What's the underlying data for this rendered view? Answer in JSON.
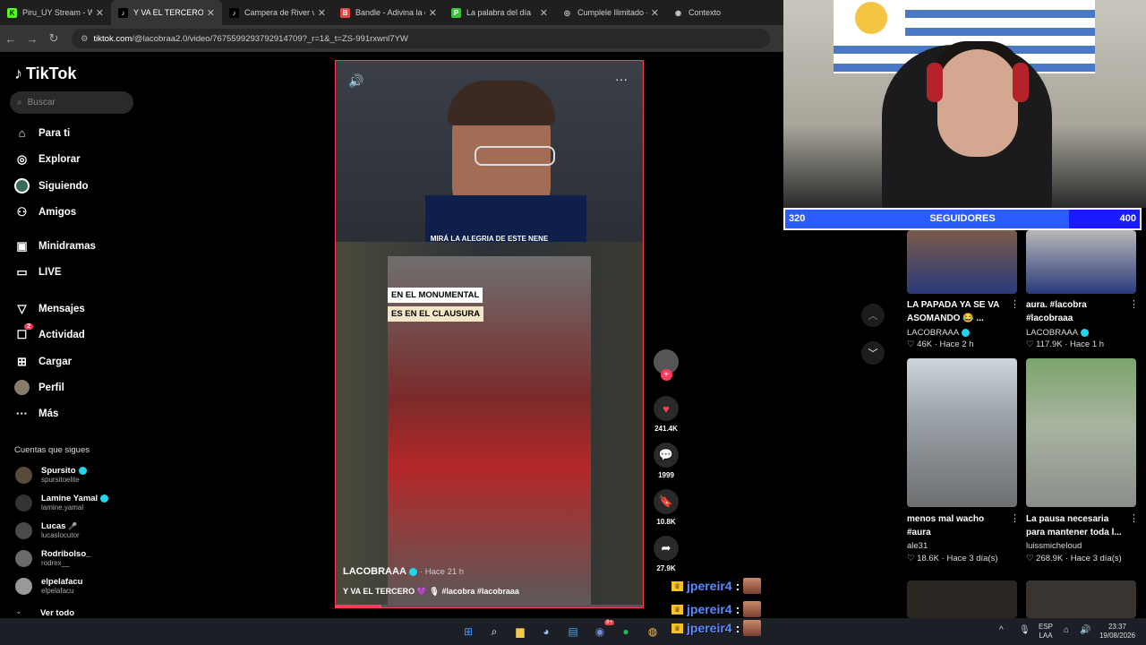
{
  "browser": {
    "tabs": [
      {
        "label": "Piru_UY Stream - Wat",
        "fav": "K",
        "fav_color": "#53fc18"
      },
      {
        "label": "Y VA EL TERCERO",
        "fav": "♪",
        "fav_color": "#ffffff",
        "active": true
      },
      {
        "label": "Campera de River vs",
        "fav": "♪",
        "fav_color": "#ffffff"
      },
      {
        "label": "Bandle - Adivina la ca",
        "fav": "B",
        "fav_color": "#e84545"
      },
      {
        "label": "La palabra del día",
        "fav": "P",
        "fav_color": "#3cc23c"
      },
      {
        "label": "Cumplele Ilimitado -",
        "fav": "◎",
        "fav_color": "#cccccc"
      },
      {
        "label": "Contexto",
        "fav": "◉",
        "fav_color": "#cccccc"
      }
    ],
    "url_domain": "tiktok.com",
    "url_path": "/@lacobraa2.0/video/7675599293792914709?_r=1&_t=ZS-991rxwnl7YW"
  },
  "sidebar": {
    "brand": "TikTok",
    "search_placeholder": "Buscar",
    "nav": [
      {
        "label": "Para ti",
        "icon": "home-icon"
      },
      {
        "label": "Explorar",
        "icon": "compass-icon"
      },
      {
        "label": "Siguiendo",
        "icon": "following-icon"
      },
      {
        "label": "Amigos",
        "icon": "friends-icon"
      },
      {
        "label": "Minidramas",
        "icon": "minidrama-icon"
      },
      {
        "label": "LIVE",
        "icon": "live-icon"
      },
      {
        "label": "Mensajes",
        "icon": "messages-icon"
      },
      {
        "label": "Actividad",
        "icon": "activity-icon",
        "badge": "2"
      },
      {
        "label": "Cargar",
        "icon": "upload-icon"
      },
      {
        "label": "Perfil",
        "icon": "profile-icon"
      },
      {
        "label": "Más",
        "icon": "more-icon"
      }
    ],
    "following_header": "Cuentas que sigues",
    "following": [
      {
        "name": "Spursito",
        "handle": "spursitoelite",
        "verified": true
      },
      {
        "name": "Lamine Yamal",
        "handle": "lamine.yamal",
        "verified": true
      },
      {
        "name": "Lucas",
        "handle": "lucaslocutor",
        "verified": false
      },
      {
        "name": "Rodribolso_",
        "handle": "rodrex__",
        "verified": false
      },
      {
        "name": "elpelafacu",
        "handle": "elpelafacu",
        "verified": false
      }
    ],
    "see_all": "Ver todo"
  },
  "video": {
    "top_caption": "MIRÁ LA ALEGRIA DE ESTE NENE",
    "overlay_line1": "EN EL MONUMENTAL",
    "overlay_line2": "ES EN EL CLAUSURA",
    "author": "LACOBRAAA",
    "ago": "· Hace 21 h",
    "description": "Y VA EL TERCERO 💜 🎙 #lacobra #lacobraaa",
    "progress": 0.15
  },
  "actions": {
    "likes": "241.4K",
    "comments": "1999",
    "saves": "10.8K",
    "shares": "27.9K"
  },
  "followers_bar": {
    "current": "320",
    "label": "SEGUIDORES",
    "goal": "400",
    "progress": 0.8
  },
  "related": [
    {
      "title": "LA PAPADA YA SE VA ASOMANDO 😂 ...",
      "author": "LACOBRAAA",
      "likes": "46K",
      "ago": "Hace 2 h"
    },
    {
      "title": "aura. #lacobra #lacobraaa",
      "author": "LACOBRAAA",
      "likes": "117.9K",
      "ago": "Hace 1 h"
    },
    {
      "title": "menos mal wacho #aura",
      "author": "ale31",
      "likes": "18.6K",
      "ago": "Hace 3 día(s)"
    },
    {
      "title": "La pausa necesaria para mantener toda l...",
      "author": "luissmicheloud",
      "likes": "268.9K",
      "ago": "Hace 3 día(s)"
    }
  ],
  "chat": [
    {
      "user": "jpereir4",
      "sep": ":"
    },
    {
      "user": "jpereir4",
      "sep": ":"
    },
    {
      "user": "jpereir4",
      "sep": ":"
    }
  ],
  "taskbar": {
    "lang_top": "ESP",
    "lang_bottom": "LAA",
    "time": "23:37",
    "date": "19/08/2026",
    "discord_badge": "9+"
  }
}
